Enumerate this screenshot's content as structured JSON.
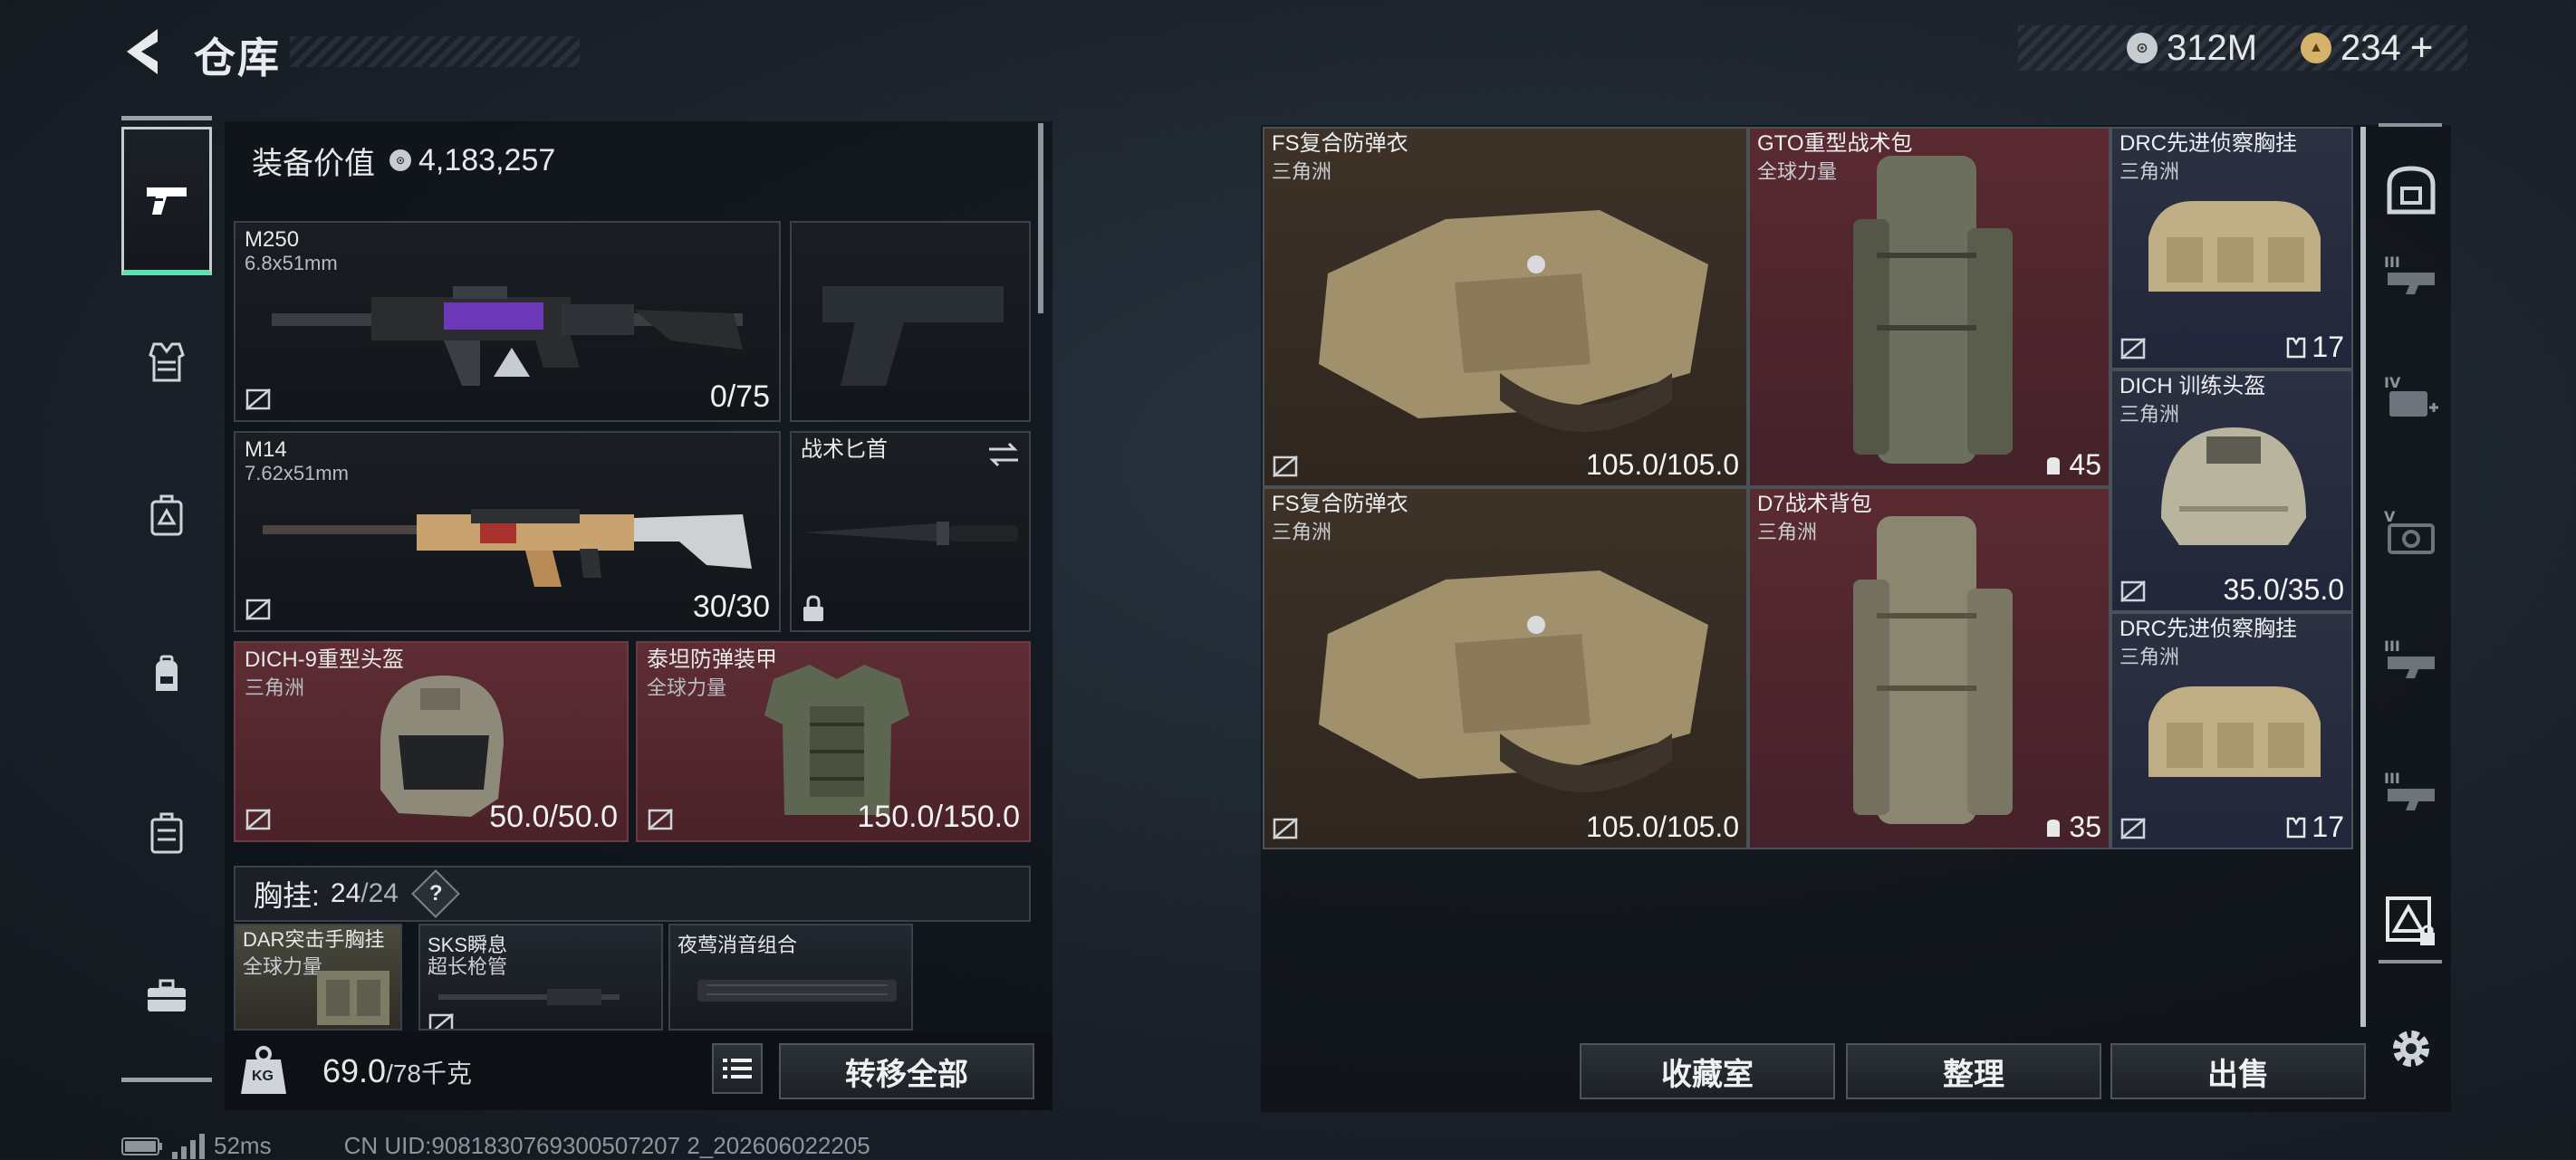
{
  "header": {
    "title": "仓库",
    "currency1_value": "312M",
    "currency2_value": "234",
    "currency2_plus": "+"
  },
  "left_nav": {
    "items": [
      "pistol-icon",
      "vest-icon",
      "rig-icon",
      "backpack-icon",
      "case-icon",
      "toolbox-icon"
    ],
    "active": "pistol-icon"
  },
  "equipment": {
    "value_label": "装备价值",
    "value": "4,183,257",
    "primary1": {
      "name": "M250",
      "caliber": "6.8x51mm",
      "ammo": "0/75"
    },
    "primary2": {
      "name": "M14",
      "caliber": "7.62x51mm",
      "ammo": "30/30"
    },
    "melee": {
      "name": "战术匕首"
    },
    "helmet": {
      "name": "DICH-9重型头盔",
      "faction": "三角洲",
      "durability": "50.0/50.0"
    },
    "armor": {
      "name": "泰坦防弹装甲",
      "faction": "全球力量",
      "durability": "150.0/150.0"
    },
    "chest_rig": {
      "label": "胸挂:",
      "used": "24",
      "total": "/24",
      "help": "?"
    },
    "attachments": [
      {
        "name": "DAR突击手胸挂",
        "sub": "全球力量"
      },
      {
        "name": "SKS瞬息",
        "sub": "超长枪管"
      },
      {
        "name": "夜莺消音组合",
        "sub": ""
      }
    ],
    "weight_value": "69.0",
    "weight_max": "/78千克",
    "weight_icon_text": "KG",
    "transfer_all": "转移全部"
  },
  "storage": {
    "items": [
      {
        "name": "FS复合防弹衣",
        "sub": "三角洲",
        "value": "105.0/105.0"
      },
      {
        "name": "GTO重型战术包",
        "sub": "全球力量",
        "value": "45"
      },
      {
        "name": "DRC先进侦察胸挂",
        "sub": "三角洲",
        "value": "17"
      },
      {
        "name": "DICH 训练头盔",
        "sub": "三角洲",
        "value": "35.0/35.0"
      },
      {
        "name": "FS复合防弹衣",
        "sub": "三角洲",
        "value": "105.0/105.0"
      },
      {
        "name": "D7战术背包",
        "sub": "三角洲",
        "value": "35"
      },
      {
        "name": "DRC先进侦察胸挂",
        "sub": "三角洲",
        "value": "17"
      }
    ],
    "buttons": {
      "collection": "收藏室",
      "organize": "整理",
      "sell": "出售"
    }
  },
  "right_nav": {
    "items": [
      "safe-box-icon",
      "rack-level-3-icon",
      "rack-level-4-icon",
      "rack-level-5-icon",
      "rack-level-3b-icon",
      "rack-level-3c-icon",
      "locked-rack-icon",
      "settings-icon"
    ]
  },
  "status": {
    "ping": "52ms",
    "uid": "CN UID:9081830769300507207 2_202606022205"
  }
}
